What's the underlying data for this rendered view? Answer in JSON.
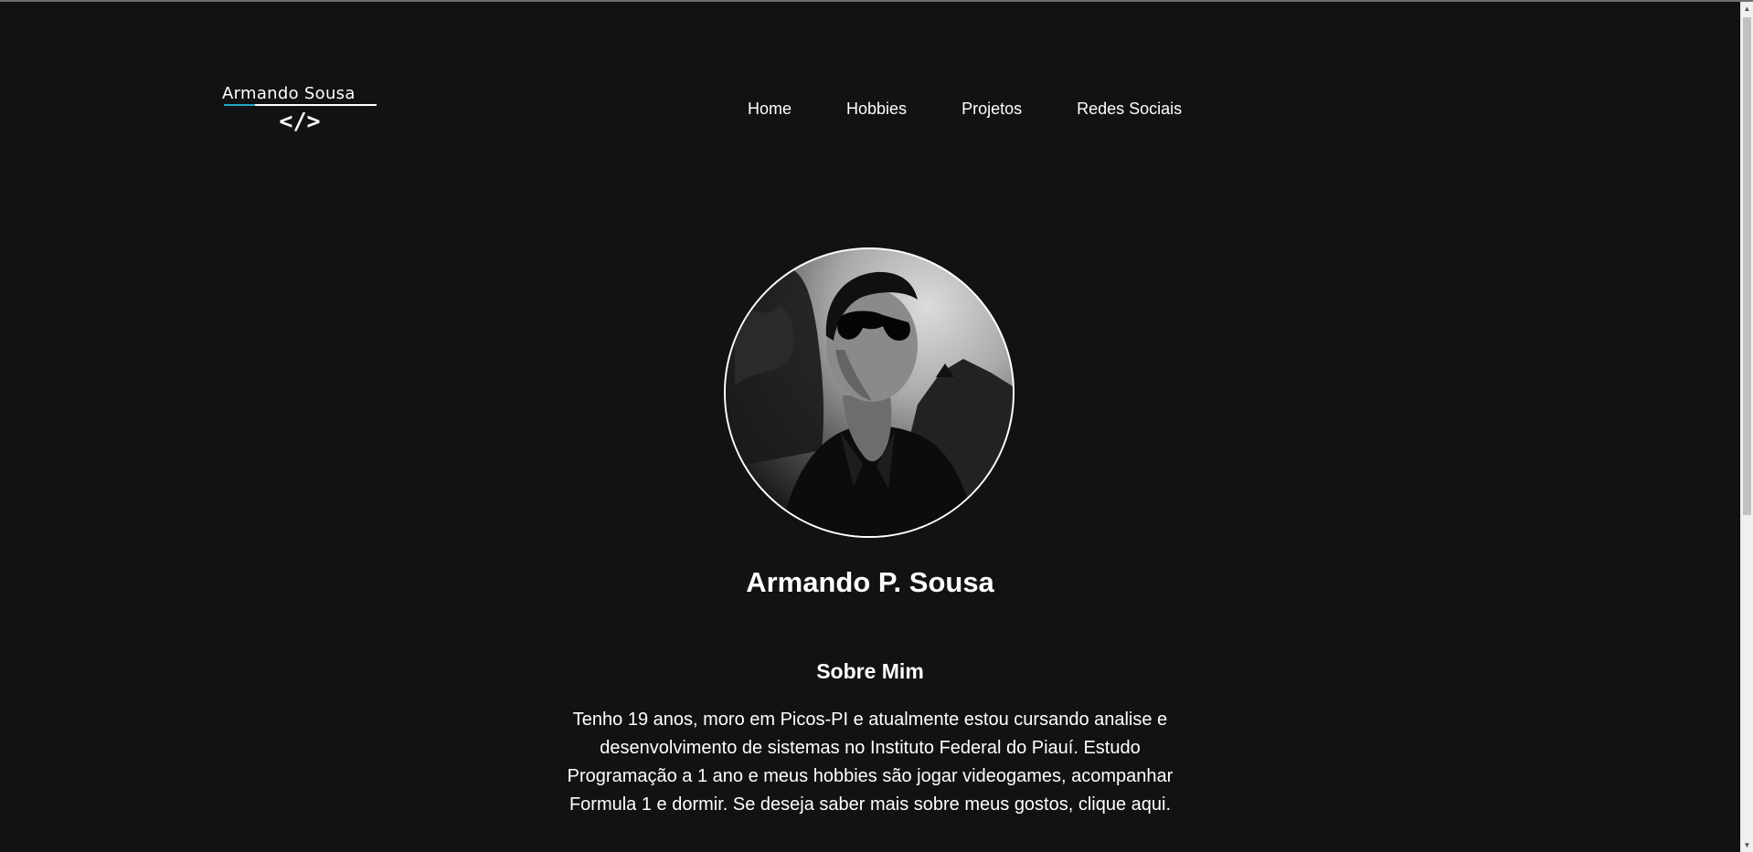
{
  "logo": {
    "name": "Armando Sousa",
    "code_glyph": "</>",
    "accent_color": "#1fa8c4"
  },
  "nav": {
    "items": [
      {
        "label": "Home"
      },
      {
        "label": "Hobbies"
      },
      {
        "label": "Projetos"
      },
      {
        "label": "Redes Sociais"
      }
    ]
  },
  "profile": {
    "name": "Armando P. Sousa",
    "photo_alt": "Foto de perfil em preto e branco"
  },
  "about": {
    "title": "Sobre Mim",
    "text": "Tenho 19 anos, moro em Picos-PI e atualmente estou cursando analise e desenvolvimento de sistemas no Instituto Federal do Piauí. Estudo Programação a 1 ano e meus hobbies são jogar videogames, acompanhar Formula 1 e dormir. Se deseja saber mais sobre meus gostos, clique aqui."
  },
  "theme": {
    "background": "#121212",
    "text": "#ffffff"
  },
  "scrollbar": {
    "up_icon": "scroll-up-arrow-icon",
    "down_icon": "scroll-down-arrow-icon"
  }
}
